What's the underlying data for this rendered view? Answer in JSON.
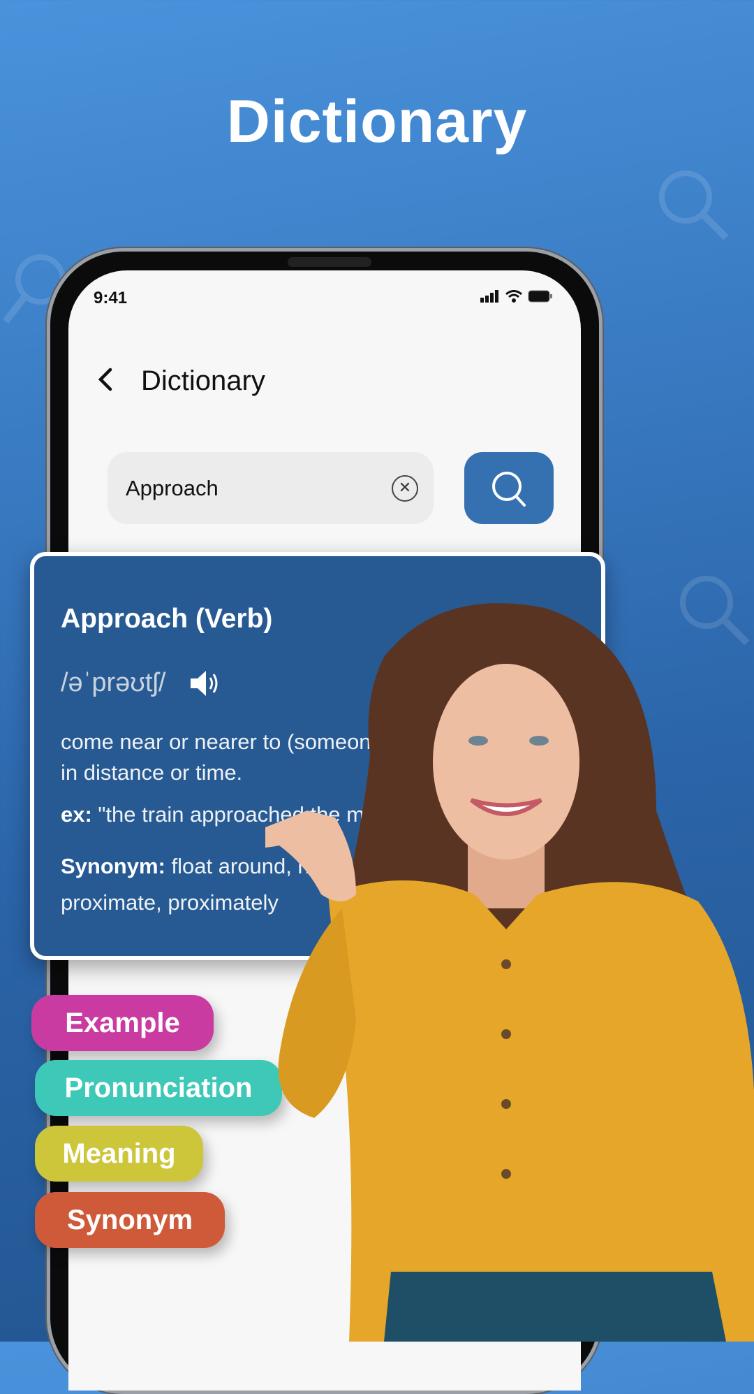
{
  "hero": {
    "title": "Dictionary"
  },
  "status_bar": {
    "time": "9:41"
  },
  "app_bar": {
    "title": "Dictionary",
    "back_icon": "chevron-left-icon"
  },
  "search": {
    "value": "Approach",
    "clear_icon": "close-circle-icon",
    "button_icon": "search-icon"
  },
  "colors": {
    "accent": "#3571b1",
    "card": "#275a92",
    "example": "#c93ba0",
    "pronunciation": "#3ec8b8",
    "meaning": "#cdc53a",
    "synonym": "#cf5a3a"
  },
  "card": {
    "title": "Approach (Verb)",
    "phonetic": "/əˈprəʊtʃ/",
    "speaker_icon": "speaker-icon",
    "definition_line1": "come near or nearer to (someone or so",
    "definition_line2": "in distance or time.",
    "example_label": "ex:",
    "example_text": " \"the train approached the main li",
    "synonym_label": "Synonym:",
    "synonym_line1": " float around, hand to han",
    "synonym_line2": "proximate, proximately"
  },
  "features": [
    {
      "label": "Example"
    },
    {
      "label": "Pronunciation"
    },
    {
      "label": "Meaning"
    },
    {
      "label": "Synonym"
    }
  ]
}
